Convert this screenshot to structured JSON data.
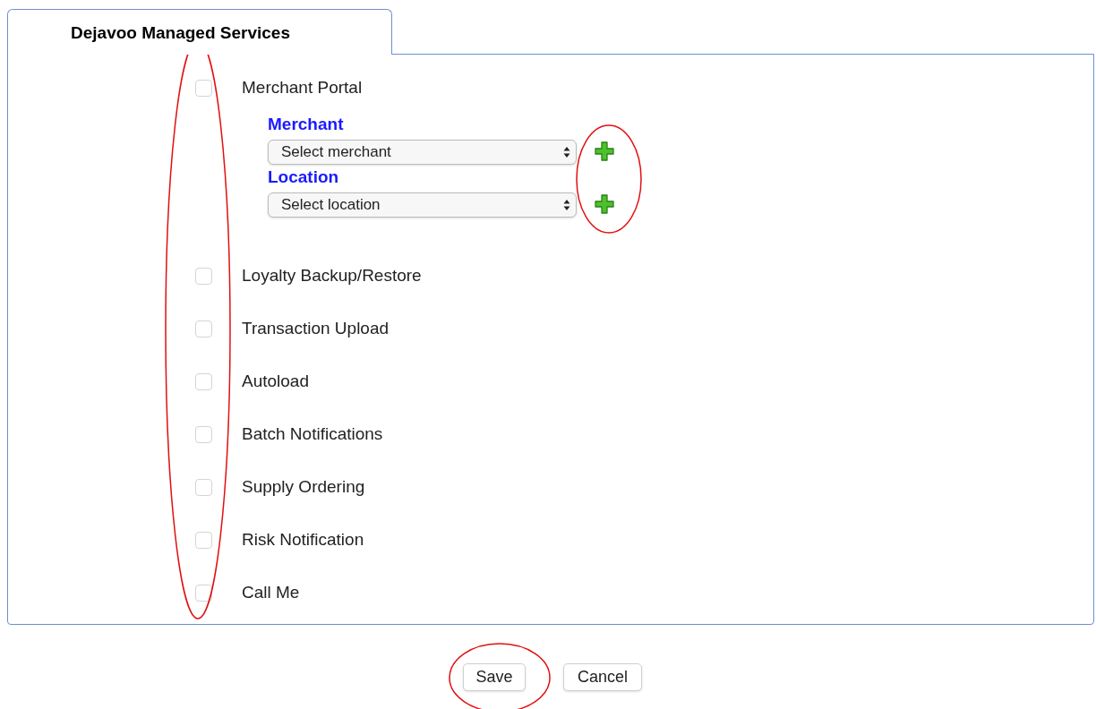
{
  "tab": {
    "label": "Dejavoo Managed Services",
    "selected": true
  },
  "services": [
    {
      "label": "Merchant Portal",
      "checked": false,
      "fields": [
        {
          "label": "Merchant",
          "value": "Select merchant"
        },
        {
          "label": "Location",
          "value": "Select location"
        }
      ]
    },
    {
      "label": "Loyalty Backup/Restore",
      "checked": false
    },
    {
      "label": "Transaction Upload",
      "checked": false
    },
    {
      "label": "Autoload",
      "checked": false
    },
    {
      "label": "Batch Notifications",
      "checked": false
    },
    {
      "label": "Supply Ordering",
      "checked": false
    },
    {
      "label": "Risk Notification",
      "checked": false
    },
    {
      "label": "Call Me",
      "checked": false
    }
  ],
  "buttons": [
    "Save",
    "Cancel"
  ]
}
